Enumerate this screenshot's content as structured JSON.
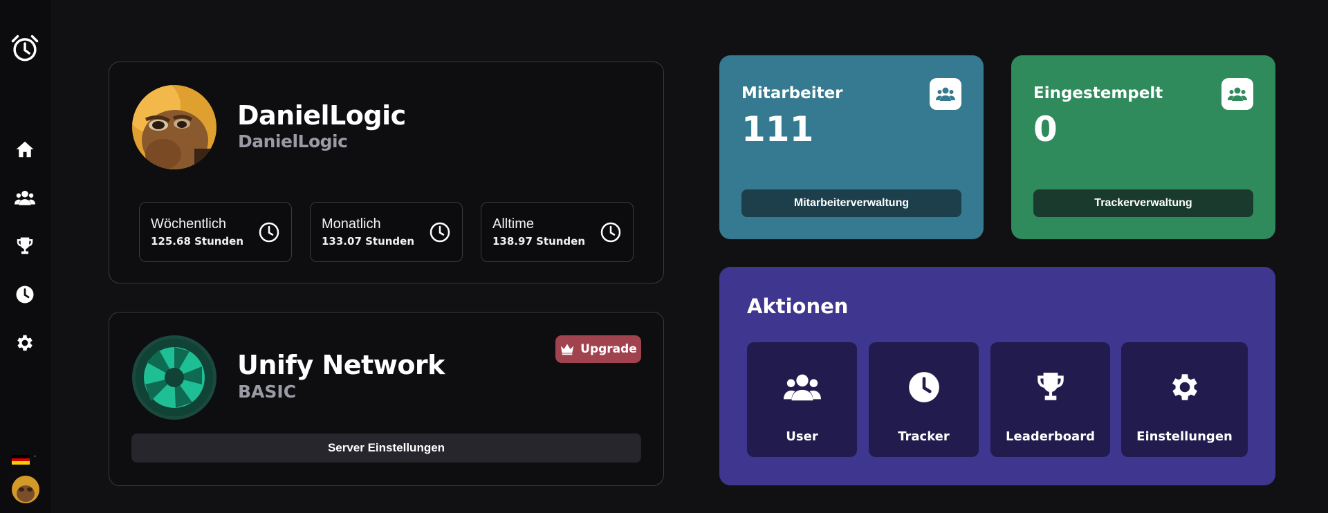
{
  "sidebar": {
    "items": [
      {
        "icon": "home-icon"
      },
      {
        "icon": "users-icon"
      },
      {
        "icon": "trophy-icon"
      },
      {
        "icon": "clock-icon"
      },
      {
        "icon": "gear-icon"
      }
    ],
    "language_flag": "german-flag-icon"
  },
  "profile": {
    "name": "DanielLogic",
    "username": "DanielLogic",
    "stats": [
      {
        "label": "Wöchentlich",
        "value": "125.68 Stunden"
      },
      {
        "label": "Monatlich",
        "value": "133.07 Stunden"
      },
      {
        "label": "Alltime",
        "value": "138.97 Stunden"
      }
    ]
  },
  "server": {
    "name": "Unify Network",
    "plan": "BASIC",
    "upgrade_label": "Upgrade",
    "settings_label": "Server Einstellungen"
  },
  "metrics": {
    "employees": {
      "title": "Mitarbeiter",
      "value": "111",
      "button": "Mitarbeiterverwaltung",
      "color": "#357a90"
    },
    "clocked_in": {
      "title": "Eingestempelt",
      "value": "0",
      "button": "Trackerverwaltung",
      "color": "#2f8a5c"
    }
  },
  "actions": {
    "title": "Aktionen",
    "color": "#3f3690",
    "items": [
      {
        "label": "User",
        "icon": "users-icon"
      },
      {
        "label": "Tracker",
        "icon": "clock-icon"
      },
      {
        "label": "Leaderboard",
        "icon": "trophy-icon"
      },
      {
        "label": "Einstellungen",
        "icon": "gear-icon"
      }
    ]
  }
}
